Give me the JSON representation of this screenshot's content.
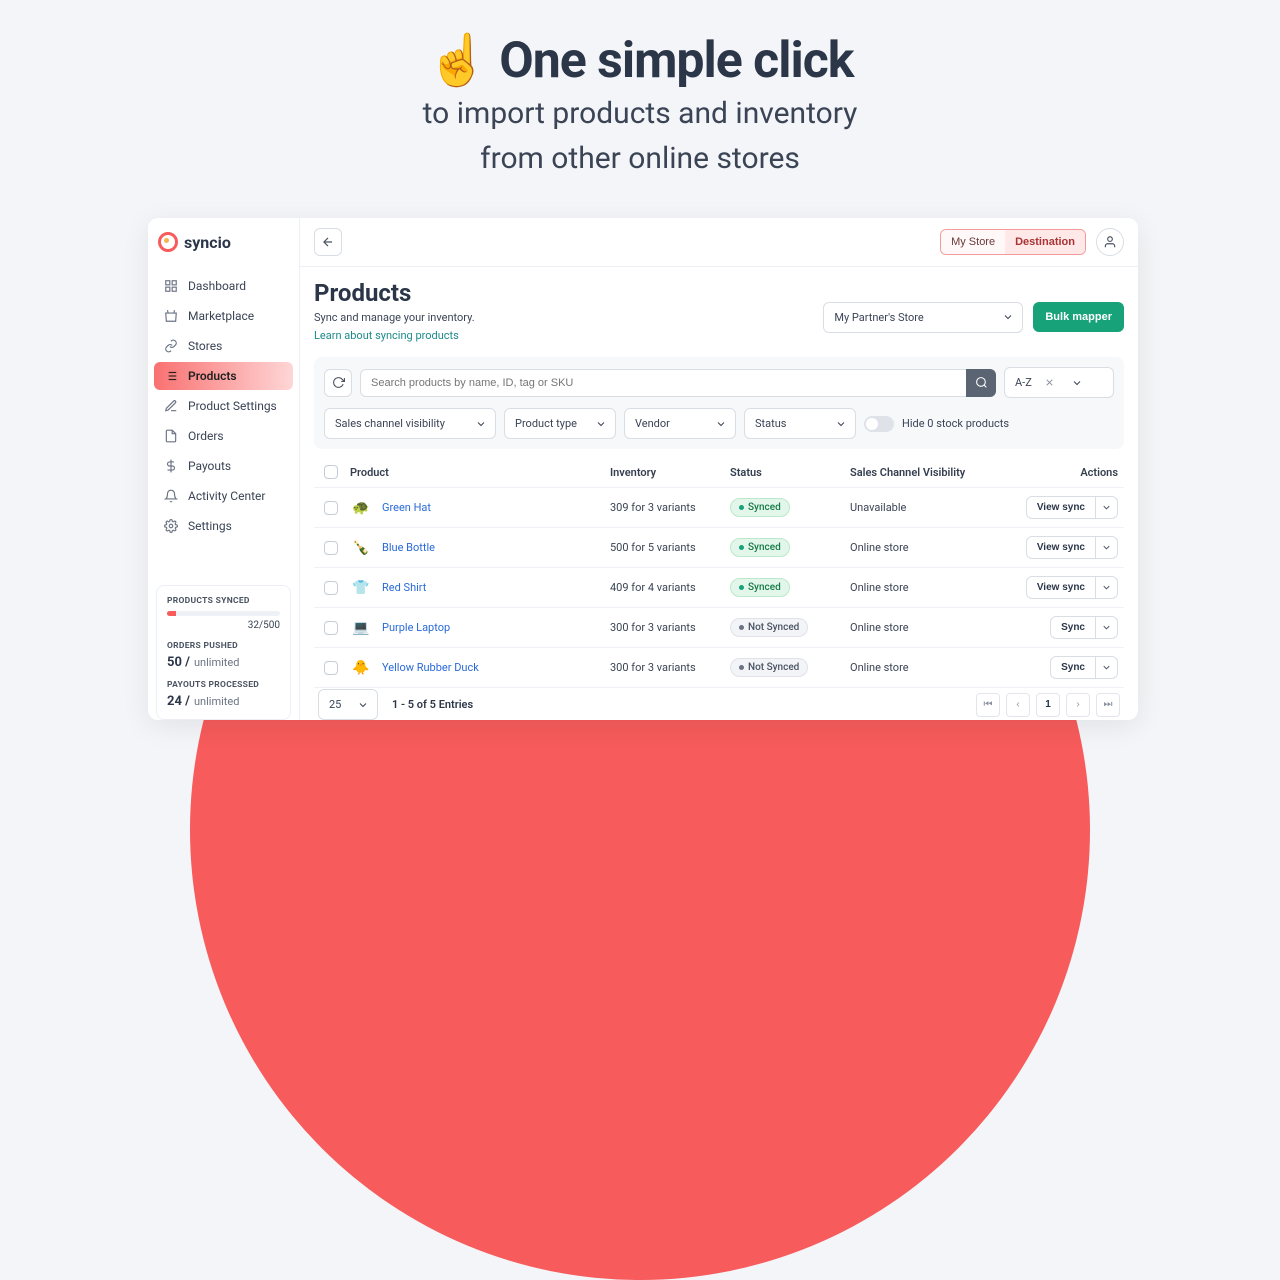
{
  "hero": {
    "emoji": "☝️",
    "title": "One simple click",
    "line1": "to import products and inventory",
    "line2": "from other online stores"
  },
  "brand": {
    "name": "syncio"
  },
  "nav": {
    "items": [
      {
        "label": "Dashboard"
      },
      {
        "label": "Marketplace"
      },
      {
        "label": "Stores"
      },
      {
        "label": "Products"
      },
      {
        "label": "Product Settings"
      },
      {
        "label": "Orders"
      },
      {
        "label": "Payouts"
      },
      {
        "label": "Activity Center"
      },
      {
        "label": "Settings"
      }
    ]
  },
  "stats": {
    "synced_label": "PRODUCTS SYNCED",
    "synced_count": "32/500",
    "orders_label": "ORDERS PUSHED",
    "orders_value": "50 /",
    "orders_unit": "unlimited",
    "payouts_label": "PAYOUTS PROCESSED",
    "payouts_value": "24 /",
    "payouts_unit": "unlimited"
  },
  "topbar": {
    "seg1": "My Store",
    "seg2": "Destination"
  },
  "page": {
    "title": "Products",
    "subtitle": "Sync and manage your inventory.",
    "learn": "Learn about syncing products",
    "store_select": "My Partner's Store",
    "bulk_btn": "Bulk mapper"
  },
  "filters": {
    "search_placeholder": "Search products by name, ID, tag or SKU",
    "sort": "A-Z",
    "f1": "Sales channel visibility",
    "f2": "Product type",
    "f3": "Vendor",
    "f4": "Status",
    "toggle_label": "Hide 0 stock products"
  },
  "table": {
    "headers": {
      "product": "Product",
      "inventory": "Inventory",
      "status": "Status",
      "visibility": "Sales Channel Visibility",
      "actions": "Actions"
    },
    "rows": [
      {
        "name": "Green Hat",
        "emoji": "🐢",
        "inventory": "309 for 3 variants",
        "status": "Synced",
        "synced": true,
        "visibility": "Unavailable",
        "action": "View sync"
      },
      {
        "name": "Blue Bottle",
        "emoji": "🍾",
        "inventory": "500 for 5 variants",
        "status": "Synced",
        "synced": true,
        "visibility": "Online store",
        "action": "View sync"
      },
      {
        "name": "Red Shirt",
        "emoji": "👕",
        "inventory": "409 for 4 variants",
        "status": "Synced",
        "synced": true,
        "visibility": "Online store",
        "action": "View sync"
      },
      {
        "name": "Purple Laptop",
        "emoji": "💻",
        "inventory": "300 for 3 variants",
        "status": "Not Synced",
        "synced": false,
        "visibility": "Online store",
        "action": "Sync"
      },
      {
        "name": "Yellow Rubber Duck",
        "emoji": "🐥",
        "inventory": "300 for 3 variants",
        "status": "Not Synced",
        "synced": false,
        "visibility": "Online store",
        "action": "Sync"
      }
    ]
  },
  "footer": {
    "per_page": "25",
    "entries": "1 - 5 of 5 Entries",
    "page": "1"
  }
}
